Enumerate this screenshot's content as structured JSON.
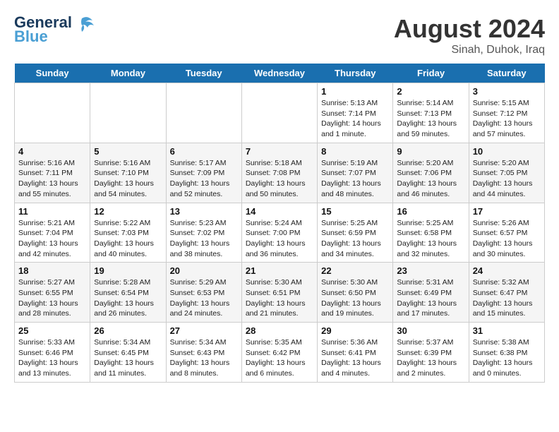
{
  "header": {
    "logo_line1": "General",
    "logo_line2": "Blue",
    "title": "August 2024",
    "subtitle": "Sinah, Duhok, Iraq"
  },
  "weekdays": [
    "Sunday",
    "Monday",
    "Tuesday",
    "Wednesday",
    "Thursday",
    "Friday",
    "Saturday"
  ],
  "weeks": [
    [
      {
        "day": "",
        "info": ""
      },
      {
        "day": "",
        "info": ""
      },
      {
        "day": "",
        "info": ""
      },
      {
        "day": "",
        "info": ""
      },
      {
        "day": "1",
        "info": "Sunrise: 5:13 AM\nSunset: 7:14 PM\nDaylight: 14 hours\nand 1 minute."
      },
      {
        "day": "2",
        "info": "Sunrise: 5:14 AM\nSunset: 7:13 PM\nDaylight: 13 hours\nand 59 minutes."
      },
      {
        "day": "3",
        "info": "Sunrise: 5:15 AM\nSunset: 7:12 PM\nDaylight: 13 hours\nand 57 minutes."
      }
    ],
    [
      {
        "day": "4",
        "info": "Sunrise: 5:16 AM\nSunset: 7:11 PM\nDaylight: 13 hours\nand 55 minutes."
      },
      {
        "day": "5",
        "info": "Sunrise: 5:16 AM\nSunset: 7:10 PM\nDaylight: 13 hours\nand 54 minutes."
      },
      {
        "day": "6",
        "info": "Sunrise: 5:17 AM\nSunset: 7:09 PM\nDaylight: 13 hours\nand 52 minutes."
      },
      {
        "day": "7",
        "info": "Sunrise: 5:18 AM\nSunset: 7:08 PM\nDaylight: 13 hours\nand 50 minutes."
      },
      {
        "day": "8",
        "info": "Sunrise: 5:19 AM\nSunset: 7:07 PM\nDaylight: 13 hours\nand 48 minutes."
      },
      {
        "day": "9",
        "info": "Sunrise: 5:20 AM\nSunset: 7:06 PM\nDaylight: 13 hours\nand 46 minutes."
      },
      {
        "day": "10",
        "info": "Sunrise: 5:20 AM\nSunset: 7:05 PM\nDaylight: 13 hours\nand 44 minutes."
      }
    ],
    [
      {
        "day": "11",
        "info": "Sunrise: 5:21 AM\nSunset: 7:04 PM\nDaylight: 13 hours\nand 42 minutes."
      },
      {
        "day": "12",
        "info": "Sunrise: 5:22 AM\nSunset: 7:03 PM\nDaylight: 13 hours\nand 40 minutes."
      },
      {
        "day": "13",
        "info": "Sunrise: 5:23 AM\nSunset: 7:02 PM\nDaylight: 13 hours\nand 38 minutes."
      },
      {
        "day": "14",
        "info": "Sunrise: 5:24 AM\nSunset: 7:00 PM\nDaylight: 13 hours\nand 36 minutes."
      },
      {
        "day": "15",
        "info": "Sunrise: 5:25 AM\nSunset: 6:59 PM\nDaylight: 13 hours\nand 34 minutes."
      },
      {
        "day": "16",
        "info": "Sunrise: 5:25 AM\nSunset: 6:58 PM\nDaylight: 13 hours\nand 32 minutes."
      },
      {
        "day": "17",
        "info": "Sunrise: 5:26 AM\nSunset: 6:57 PM\nDaylight: 13 hours\nand 30 minutes."
      }
    ],
    [
      {
        "day": "18",
        "info": "Sunrise: 5:27 AM\nSunset: 6:55 PM\nDaylight: 13 hours\nand 28 minutes."
      },
      {
        "day": "19",
        "info": "Sunrise: 5:28 AM\nSunset: 6:54 PM\nDaylight: 13 hours\nand 26 minutes."
      },
      {
        "day": "20",
        "info": "Sunrise: 5:29 AM\nSunset: 6:53 PM\nDaylight: 13 hours\nand 24 minutes."
      },
      {
        "day": "21",
        "info": "Sunrise: 5:30 AM\nSunset: 6:51 PM\nDaylight: 13 hours\nand 21 minutes."
      },
      {
        "day": "22",
        "info": "Sunrise: 5:30 AM\nSunset: 6:50 PM\nDaylight: 13 hours\nand 19 minutes."
      },
      {
        "day": "23",
        "info": "Sunrise: 5:31 AM\nSunset: 6:49 PM\nDaylight: 13 hours\nand 17 minutes."
      },
      {
        "day": "24",
        "info": "Sunrise: 5:32 AM\nSunset: 6:47 PM\nDaylight: 13 hours\nand 15 minutes."
      }
    ],
    [
      {
        "day": "25",
        "info": "Sunrise: 5:33 AM\nSunset: 6:46 PM\nDaylight: 13 hours\nand 13 minutes."
      },
      {
        "day": "26",
        "info": "Sunrise: 5:34 AM\nSunset: 6:45 PM\nDaylight: 13 hours\nand 11 minutes."
      },
      {
        "day": "27",
        "info": "Sunrise: 5:34 AM\nSunset: 6:43 PM\nDaylight: 13 hours\nand 8 minutes."
      },
      {
        "day": "28",
        "info": "Sunrise: 5:35 AM\nSunset: 6:42 PM\nDaylight: 13 hours\nand 6 minutes."
      },
      {
        "day": "29",
        "info": "Sunrise: 5:36 AM\nSunset: 6:41 PM\nDaylight: 13 hours\nand 4 minutes."
      },
      {
        "day": "30",
        "info": "Sunrise: 5:37 AM\nSunset: 6:39 PM\nDaylight: 13 hours\nand 2 minutes."
      },
      {
        "day": "31",
        "info": "Sunrise: 5:38 AM\nSunset: 6:38 PM\nDaylight: 13 hours\nand 0 minutes."
      }
    ]
  ]
}
